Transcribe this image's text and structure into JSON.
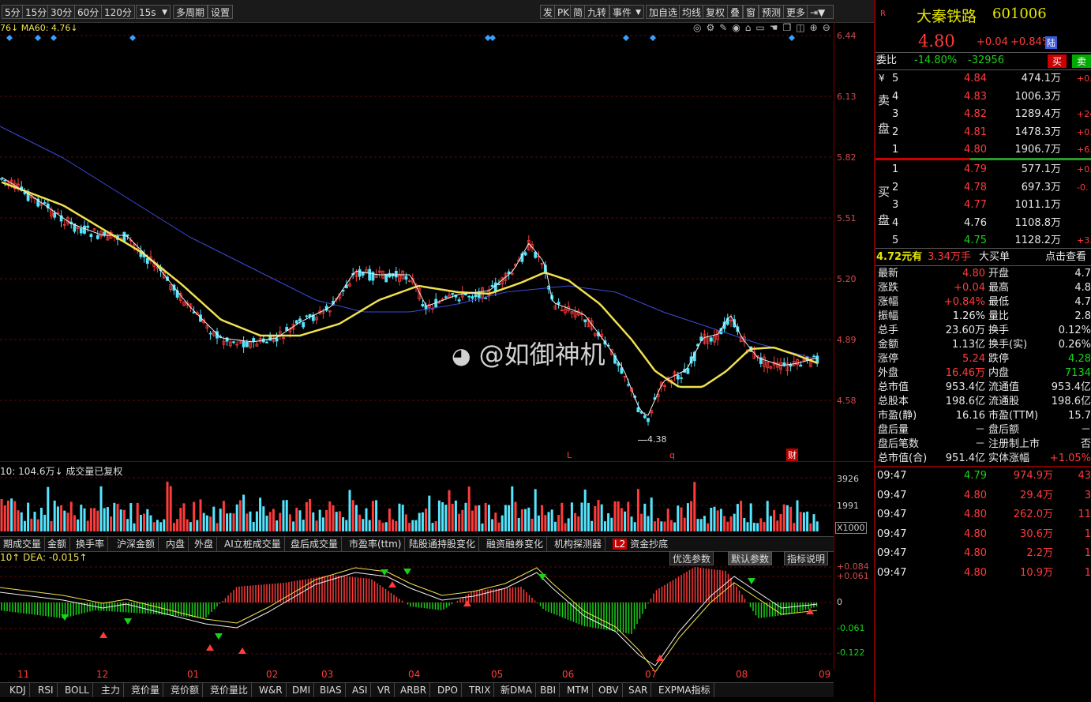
{
  "toolbar": {
    "periods": [
      "5分",
      "15分",
      "30分",
      "60分",
      "120分",
      "15s",
      "多周期",
      "设置"
    ],
    "right_buttons": [
      "发",
      "PK",
      "简",
      "九转",
      "事件",
      "加自选",
      "均线",
      "复权",
      "叠",
      "窗",
      "预测",
      "更多"
    ]
  },
  "chart": {
    "ma_legend": "76↓  MA60: 4.76↓",
    "price_ticks": [
      "6.44",
      "6.13",
      "5.82",
      "5.51",
      "5.20",
      "4.89",
      "4.58"
    ],
    "low_marker": "4.38",
    "event_markers": [
      "L",
      "q",
      "财"
    ],
    "watermark": "@如御神机",
    "toolbar_icons": [
      "target-icon",
      "gear-icon",
      "pen-icon",
      "eye-icon",
      "lock-icon",
      "box-icon",
      "hand-icon",
      "copy-icon",
      "lock2-icon",
      "plus-icon",
      "minus-icon"
    ]
  },
  "volume": {
    "legend": "10: 104.6万↓  成交量已复权",
    "ticks": [
      "3926",
      "1991",
      "X1000"
    ]
  },
  "indicator_tabs": [
    "期成交量",
    "金额",
    "换手率",
    "沪深金额",
    "内盘",
    "外盘",
    "AI立桩成交量",
    "盘后成交量",
    "市盈率(ttm)",
    "陆股通持股变化",
    "融资融券变化",
    "机构探测器",
    "资金抄底"
  ],
  "indicator_badge": "L2",
  "macd": {
    "legend": "10↑  DEA: -0.015↑",
    "buttons": [
      "优选参数",
      "默认参数",
      "指标说明"
    ],
    "ticks": [
      "+0.084",
      "+0.061",
      "0",
      "-0.061",
      "-0.122"
    ]
  },
  "x_labels": [
    "11",
    "12",
    "01",
    "02",
    "03",
    "04",
    "05",
    "06",
    "07",
    "08",
    "09"
  ],
  "bottom_tabs": [
    "KDJ",
    "RSI",
    "BOLL",
    "主力",
    "竞价量",
    "竞价额",
    "竞价量比",
    "W&R",
    "DMI",
    "BIAS",
    "ASI",
    "VR",
    "ARBR",
    "DPO",
    "TRIX",
    "新DMA",
    "BBI",
    "MTM",
    "OBV",
    "SAR",
    "EXPMA指标"
  ],
  "quote": {
    "r_badge": "R",
    "name": "大秦铁路",
    "code": "601006",
    "price": "4.80",
    "change": "+0.04",
    "change_pct": "+0.84%",
    "lu_badge": "陆",
    "weibi_label": "委比",
    "weibi_pct": "-14.80%",
    "weibi_diff": "-32956",
    "buy_btn": "买",
    "sell_btn": "卖",
    "sell_label": [
      "卖",
      "盘"
    ],
    "buy_label": [
      "买",
      "盘"
    ],
    "sell_levels": [
      {
        "lvl": "5",
        "price": "4.84",
        "vol": "474.1万",
        "extra": "+0."
      },
      {
        "lvl": "4",
        "price": "4.83",
        "vol": "1006.3万",
        "extra": ""
      },
      {
        "lvl": "3",
        "price": "4.82",
        "vol": "1289.4万",
        "extra": "+24."
      },
      {
        "lvl": "2",
        "price": "4.81",
        "vol": "1478.3万",
        "extra": "+0."
      },
      {
        "lvl": "1",
        "price": "4.80",
        "vol": "1906.7万",
        "extra": "+6."
      }
    ],
    "buy_levels": [
      {
        "lvl": "1",
        "price": "4.79",
        "vol": "577.1万",
        "extra": "+0."
      },
      {
        "lvl": "2",
        "price": "4.78",
        "vol": "697.3万",
        "extra": "-0."
      },
      {
        "lvl": "3",
        "price": "4.77",
        "vol": "1011.1万",
        "extra": ""
      },
      {
        "lvl": "4",
        "price": "4.76",
        "vol": "1108.8万",
        "extra": ""
      },
      {
        "lvl": "5",
        "price": "4.75",
        "vol": "1128.2万",
        "extra": "+3."
      }
    ],
    "big_order": {
      "price": "4.72元有",
      "vol": "3.34万手",
      "label": "大买单",
      "link": "点击查看"
    },
    "stats": [
      {
        "k1": "最新",
        "v1": "4.80",
        "k2": "开盘",
        "v2": "4.7"
      },
      {
        "k1": "涨跌",
        "v1": "+0.04",
        "k2": "最高",
        "v2": "4.8"
      },
      {
        "k1": "涨幅",
        "v1": "+0.84%",
        "k2": "最低",
        "v2": "4.7"
      },
      {
        "k1": "振幅",
        "v1": "1.26%",
        "k2": "量比",
        "v2": "2.8"
      },
      {
        "k1": "总手",
        "v1": "23.60万",
        "k2": "换手",
        "v2": "0.12%"
      },
      {
        "k1": "金额",
        "v1": "1.13亿",
        "k2": "换手(实)",
        "v2": "0.26%"
      },
      {
        "k1": "涨停",
        "v1": "5.24",
        "k2": "跌停",
        "v2": "4.28"
      },
      {
        "k1": "外盘",
        "v1": "16.46万",
        "k2": "内盘",
        "v2": "7134"
      },
      {
        "k1": "总市值",
        "v1": "953.4亿",
        "k2": "流通值",
        "v2": "953.4亿"
      },
      {
        "k1": "总股本",
        "v1": "198.6亿",
        "k2": "流通股",
        "v2": "198.6亿"
      },
      {
        "k1": "市盈(静)",
        "v1": "16.16",
        "k2": "市盈(TTM)",
        "v2": "15.7"
      },
      {
        "k1": "盘后量",
        "v1": "－",
        "k2": "盘后额",
        "v2": "－"
      },
      {
        "k1": "盘后笔数",
        "v1": "－",
        "k2": "注册制上市",
        "v2": "否"
      },
      {
        "k1": "总市值(合)",
        "v1": "951.4亿",
        "k2": "实体涨幅",
        "v2": "+1.05%"
      }
    ],
    "ticks": [
      {
        "time": "09:47",
        "price": "4.79",
        "vol": "974.9万",
        "n": "43"
      },
      {
        "time": "09:47",
        "price": "4.80",
        "vol": "29.4万",
        "n": "3"
      },
      {
        "time": "09:47",
        "price": "4.80",
        "vol": "262.0万",
        "n": "11"
      },
      {
        "time": "09:47",
        "price": "4.80",
        "vol": "30.6万",
        "n": "1"
      },
      {
        "time": "09:47",
        "price": "4.80",
        "vol": "2.2万",
        "n": "1"
      },
      {
        "time": "09:47",
        "price": "4.80",
        "vol": "10.9万",
        "n": "1"
      }
    ]
  },
  "colors": {
    "up": "#ff3b3b",
    "down": "#19d219",
    "ma_yellow": "#f0e050",
    "ma_blue": "#3a4bd8",
    "grid": "#5a0a0a"
  }
}
